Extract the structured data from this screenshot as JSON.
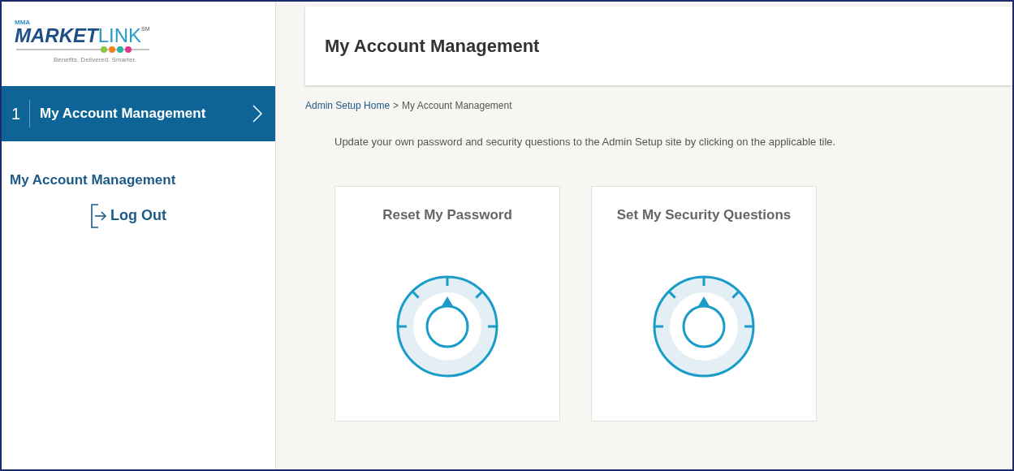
{
  "logo": {
    "prefix": "MMA",
    "brand_dark": "MARKET",
    "brand_light": "LINK",
    "mark": "SM",
    "tagline": "Benefits. Delivered. Smarter."
  },
  "steps": [
    {
      "number": "1",
      "label": "My Account Management",
      "selected": true
    }
  ],
  "sidebar": {
    "heading": "My Account Management",
    "logout": "Log Out"
  },
  "header": {
    "title": "My Account Management"
  },
  "breadcrumb": {
    "link": "Admin Setup Home",
    "separator": ">",
    "current": "My Account Management"
  },
  "intro": "Update your own password and security questions to the Admin Setup site by clicking on the applicable tile.",
  "tiles": [
    {
      "title": "Reset My Password"
    },
    {
      "title": "Set My Security Questions"
    }
  ]
}
